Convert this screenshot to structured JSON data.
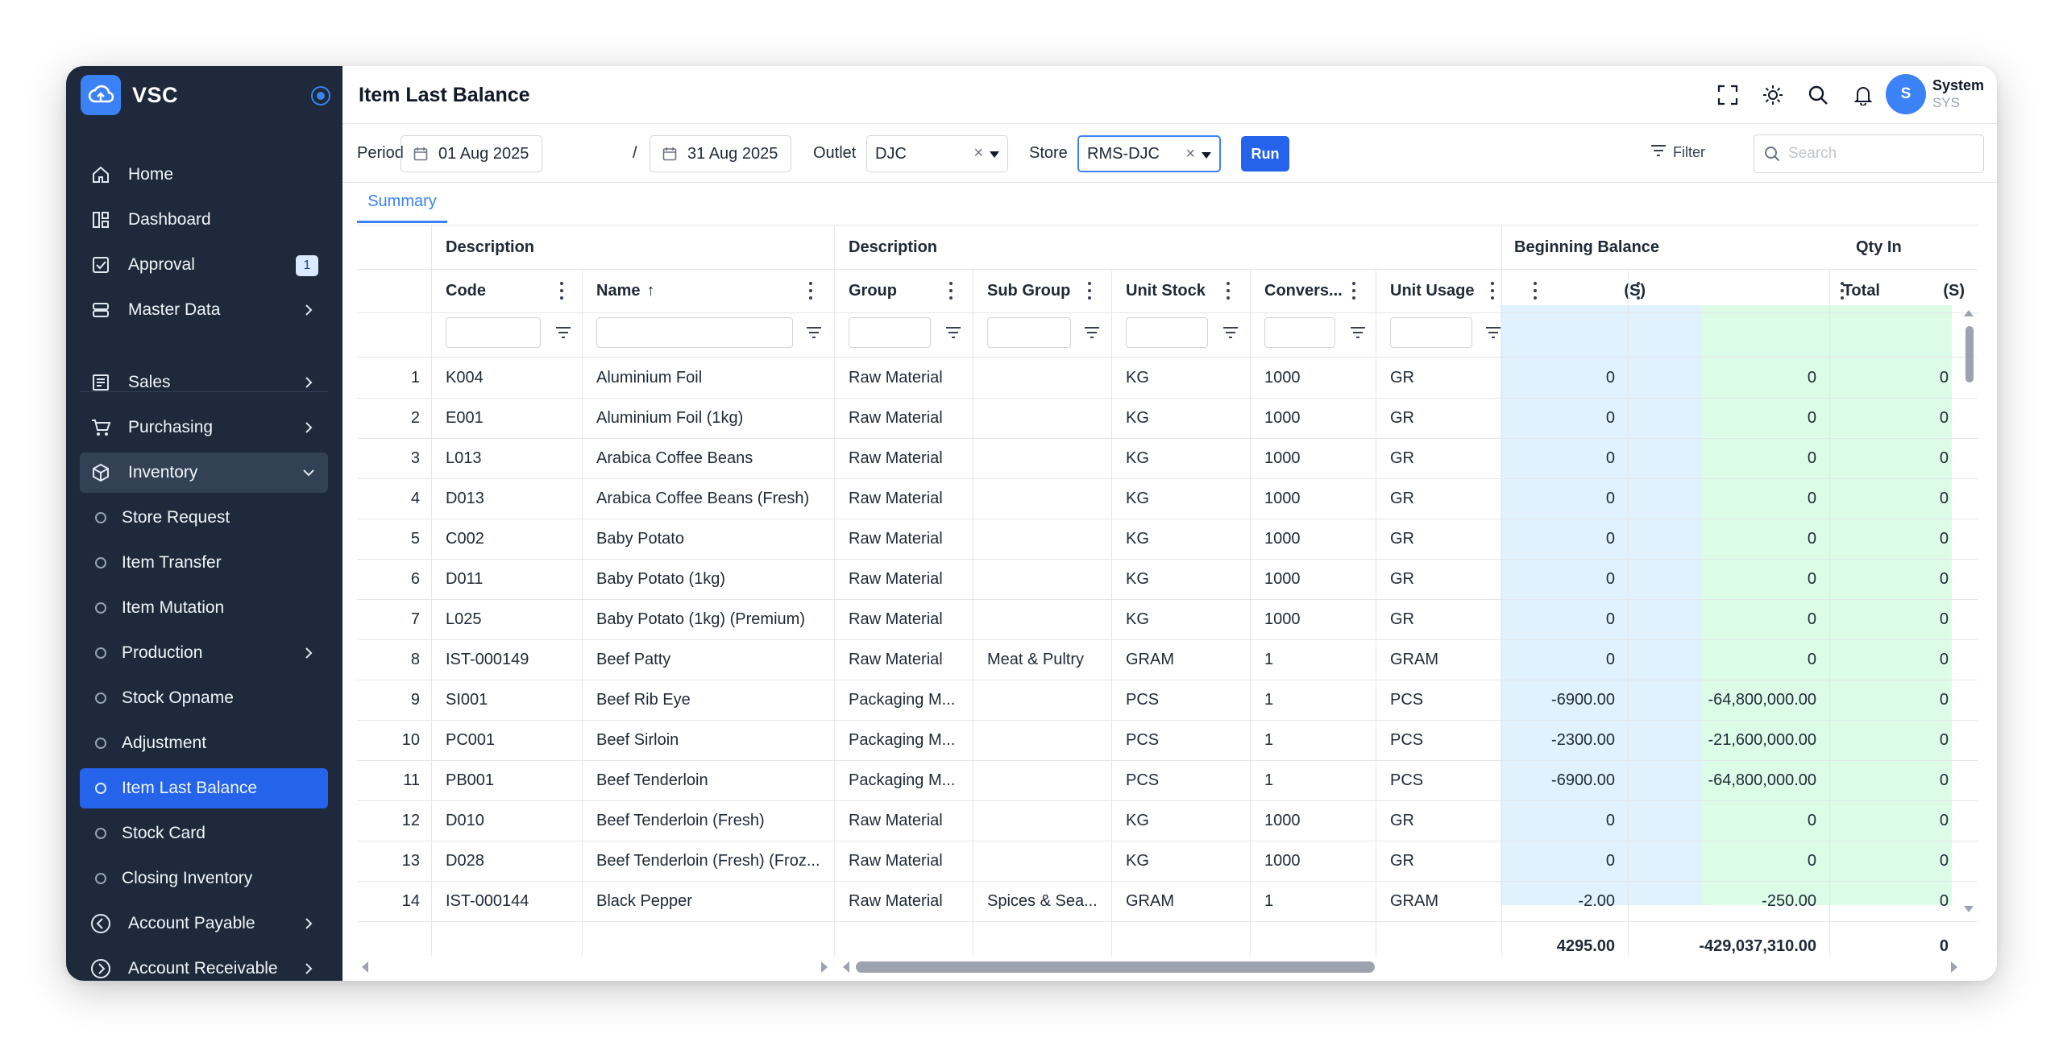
{
  "app": {
    "name": "VSC",
    "page_title": "Item Last Balance"
  },
  "sidebar": {
    "items": [
      {
        "label": "Home",
        "icon": "home-icon"
      },
      {
        "label": "Dashboard",
        "icon": "dashboard-icon"
      },
      {
        "label": "Approval",
        "icon": "approval-icon",
        "badge": "1"
      },
      {
        "label": "Master Data",
        "icon": "master-data-icon",
        "has_children": true
      },
      {
        "label": "Sales",
        "icon": "sales-icon",
        "has_children": true
      },
      {
        "label": "Purchasing",
        "icon": "cart-icon",
        "has_children": true
      },
      {
        "label": "Inventory",
        "icon": "box-icon",
        "expanded": true
      },
      {
        "label": "Store Request",
        "sub": true
      },
      {
        "label": "Item Transfer",
        "sub": true
      },
      {
        "label": "Item Mutation",
        "sub": true
      },
      {
        "label": "Production",
        "sub": true,
        "has_children": true
      },
      {
        "label": "Stock Opname",
        "sub": true
      },
      {
        "label": "Adjustment",
        "sub": true
      },
      {
        "label": "Item Last Balance",
        "sub": true,
        "active": true
      },
      {
        "label": "Stock Card",
        "sub": true
      },
      {
        "label": "Closing Inventory",
        "sub": true
      },
      {
        "label": "Account Payable",
        "icon": "arrow-left-circle-icon",
        "has_children": true
      },
      {
        "label": "Account Receivable",
        "icon": "arrow-right-circle-icon",
        "has_children": true
      }
    ]
  },
  "user": {
    "initial": "S",
    "name": "System",
    "role": "SYS"
  },
  "toolbar": {
    "period_label": "Period",
    "date_from": "01 Aug 2025",
    "date_sep": "/",
    "date_to": "31 Aug 2025",
    "outlet_label": "Outlet",
    "outlet_value": "DJC",
    "store_label": "Store",
    "store_value": "RMS-DJC",
    "run_label": "Run",
    "filter_label": "Filter",
    "search_placeholder": "Search"
  },
  "tabs": [
    {
      "label": "Summary",
      "active": true
    }
  ],
  "grid": {
    "group_headers": [
      "Description",
      "Description",
      "Beginning Balance",
      "Qty In"
    ],
    "columns": [
      "Code",
      "Name",
      "Group",
      "Sub Group",
      "Unit Stock",
      "Convers...",
      "Unit Usage",
      "(S)",
      "Total",
      "(S)"
    ],
    "sort_indicator": "↑",
    "rows": [
      {
        "no": "1",
        "code": "K004",
        "name": "Aluminium Foil",
        "group": "Raw Material",
        "sub_group": "",
        "unit_stock": "KG",
        "conv": "1000",
        "unit_usage": "GR",
        "bb_s": "0",
        "bb_total": "0",
        "qi_s": "0"
      },
      {
        "no": "2",
        "code": "E001",
        "name": "Aluminium Foil (1kg)",
        "group": "Raw Material",
        "sub_group": "",
        "unit_stock": "KG",
        "conv": "1000",
        "unit_usage": "GR",
        "bb_s": "0",
        "bb_total": "0",
        "qi_s": "0"
      },
      {
        "no": "3",
        "code": "L013",
        "name": "Arabica Coffee Beans",
        "group": "Raw Material",
        "sub_group": "",
        "unit_stock": "KG",
        "conv": "1000",
        "unit_usage": "GR",
        "bb_s": "0",
        "bb_total": "0",
        "qi_s": "0"
      },
      {
        "no": "4",
        "code": "D013",
        "name": "Arabica Coffee Beans (Fresh)",
        "group": "Raw Material",
        "sub_group": "",
        "unit_stock": "KG",
        "conv": "1000",
        "unit_usage": "GR",
        "bb_s": "0",
        "bb_total": "0",
        "qi_s": "0"
      },
      {
        "no": "5",
        "code": "C002",
        "name": "Baby Potato",
        "group": "Raw Material",
        "sub_group": "",
        "unit_stock": "KG",
        "conv": "1000",
        "unit_usage": "GR",
        "bb_s": "0",
        "bb_total": "0",
        "qi_s": "0"
      },
      {
        "no": "6",
        "code": "D011",
        "name": "Baby Potato (1kg)",
        "group": "Raw Material",
        "sub_group": "",
        "unit_stock": "KG",
        "conv": "1000",
        "unit_usage": "GR",
        "bb_s": "0",
        "bb_total": "0",
        "qi_s": "0"
      },
      {
        "no": "7",
        "code": "L025",
        "name": "Baby Potato (1kg) (Premium)",
        "group": "Raw Material",
        "sub_group": "",
        "unit_stock": "KG",
        "conv": "1000",
        "unit_usage": "GR",
        "bb_s": "0",
        "bb_total": "0",
        "qi_s": "0"
      },
      {
        "no": "8",
        "code": "IST-000149",
        "name": "Beef Patty",
        "group": "Raw Material",
        "sub_group": "Meat & Pultry",
        "unit_stock": "GRAM",
        "conv": "1",
        "unit_usage": "GRAM",
        "bb_s": "0",
        "bb_total": "0",
        "qi_s": "0"
      },
      {
        "no": "9",
        "code": "SI001",
        "name": "Beef Rib Eye",
        "group": "Packaging M...",
        "sub_group": "",
        "unit_stock": "PCS",
        "conv": "1",
        "unit_usage": "PCS",
        "bb_s": "-6900.00",
        "bb_total": "-64,800,000.00",
        "qi_s": "0"
      },
      {
        "no": "10",
        "code": "PC001",
        "name": "Beef Sirloin",
        "group": "Packaging M...",
        "sub_group": "",
        "unit_stock": "PCS",
        "conv": "1",
        "unit_usage": "PCS",
        "bb_s": "-2300.00",
        "bb_total": "-21,600,000.00",
        "qi_s": "0"
      },
      {
        "no": "11",
        "code": "PB001",
        "name": "Beef Tenderloin",
        "group": "Packaging M...",
        "sub_group": "",
        "unit_stock": "PCS",
        "conv": "1",
        "unit_usage": "PCS",
        "bb_s": "-6900.00",
        "bb_total": "-64,800,000.00",
        "qi_s": "0"
      },
      {
        "no": "12",
        "code": "D010",
        "name": "Beef Tenderloin (Fresh)",
        "group": "Raw Material",
        "sub_group": "",
        "unit_stock": "KG",
        "conv": "1000",
        "unit_usage": "GR",
        "bb_s": "0",
        "bb_total": "0",
        "qi_s": "0"
      },
      {
        "no": "13",
        "code": "D028",
        "name": "Beef Tenderloin (Fresh) (Froz...",
        "group": "Raw Material",
        "sub_group": "",
        "unit_stock": "KG",
        "conv": "1000",
        "unit_usage": "GR",
        "bb_s": "0",
        "bb_total": "0",
        "qi_s": "0"
      },
      {
        "no": "14",
        "code": "IST-000144",
        "name": "Black Pepper",
        "group": "Raw Material",
        "sub_group": "Spices & Sea...",
        "unit_stock": "GRAM",
        "conv": "1",
        "unit_usage": "GRAM",
        "bb_s": "-2.00",
        "bb_total": "-250.00",
        "qi_s": "0"
      }
    ],
    "footer": {
      "bb_s": "4295.00",
      "bb_total": "-429,037,310.00",
      "qi_s": "0"
    }
  },
  "colors": {
    "sidebar_bg": "#1e293b",
    "accent": "#2563eb",
    "beginning_balance_bg": "#e0f2fe",
    "qty_in_bg": "#dcfce7"
  }
}
